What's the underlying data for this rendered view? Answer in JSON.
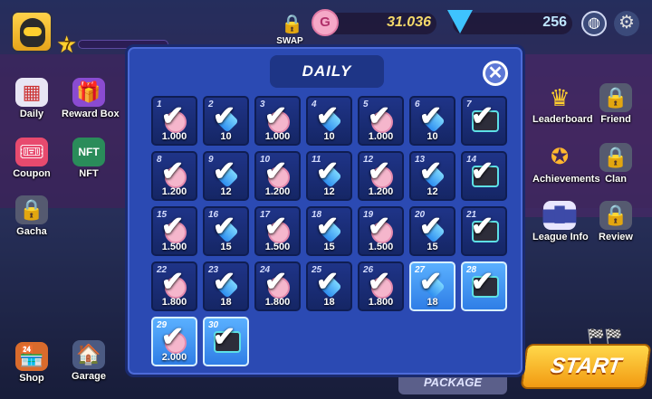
{
  "topbar": {
    "level": "7",
    "swap_label": "SWAP",
    "coin_icon_letter": "G",
    "coins": "31.036",
    "gems": "256"
  },
  "left_menu": [
    {
      "label": "Daily",
      "icon": "calendar-icon"
    },
    {
      "label": "Reward Box",
      "icon": "gift-icon"
    },
    {
      "label": "Coupon",
      "icon": "ticket-icon"
    },
    {
      "label": "NFT",
      "icon": "nft-icon"
    },
    {
      "label": "Gacha",
      "icon": "lock-icon"
    },
    {
      "label": "Shop",
      "icon": "shop-icon"
    },
    {
      "label": "Garage",
      "icon": "garage-icon"
    }
  ],
  "right_menu": [
    {
      "label": "Leaderboard",
      "icon": "crown-icon"
    },
    {
      "label": "Friend",
      "icon": "lock-icon"
    },
    {
      "label": "Achievements",
      "icon": "medal-icon"
    },
    {
      "label": "Clan",
      "icon": "lock-icon"
    },
    {
      "label": "League Info",
      "icon": "podium-icon"
    },
    {
      "label": "Review",
      "icon": "lock-icon"
    }
  ],
  "bottom": {
    "start_label": "START",
    "package_label": "PACKAGE"
  },
  "modal": {
    "title": "DAILY",
    "close_symbol": "✕",
    "rewards": [
      {
        "day": "1",
        "amount": "1.000",
        "type": "coin",
        "claimed": true
      },
      {
        "day": "2",
        "amount": "10",
        "type": "gem",
        "claimed": true
      },
      {
        "day": "3",
        "amount": "1.000",
        "type": "coin",
        "claimed": true
      },
      {
        "day": "4",
        "amount": "10",
        "type": "gem",
        "claimed": true
      },
      {
        "day": "5",
        "amount": "1.000",
        "type": "coin",
        "claimed": true
      },
      {
        "day": "6",
        "amount": "10",
        "type": "gem",
        "claimed": true
      },
      {
        "day": "7",
        "amount": "",
        "type": "chest",
        "claimed": true
      },
      {
        "day": "8",
        "amount": "1.200",
        "type": "coin",
        "claimed": true
      },
      {
        "day": "9",
        "amount": "12",
        "type": "gem",
        "claimed": true
      },
      {
        "day": "10",
        "amount": "1.200",
        "type": "coin",
        "claimed": true
      },
      {
        "day": "11",
        "amount": "12",
        "type": "gem",
        "claimed": true
      },
      {
        "day": "12",
        "amount": "1.200",
        "type": "coin",
        "claimed": true
      },
      {
        "day": "13",
        "amount": "12",
        "type": "gem",
        "claimed": true
      },
      {
        "day": "14",
        "amount": "",
        "type": "chest",
        "claimed": true
      },
      {
        "day": "15",
        "amount": "1.500",
        "type": "coin",
        "claimed": true
      },
      {
        "day": "16",
        "amount": "15",
        "type": "gem",
        "claimed": true
      },
      {
        "day": "17",
        "amount": "1.500",
        "type": "coin",
        "claimed": true
      },
      {
        "day": "18",
        "amount": "15",
        "type": "gem",
        "claimed": true
      },
      {
        "day": "19",
        "amount": "1.500",
        "type": "coin",
        "claimed": true
      },
      {
        "day": "20",
        "amount": "15",
        "type": "gem",
        "claimed": true
      },
      {
        "day": "21",
        "amount": "",
        "type": "chest",
        "claimed": true
      },
      {
        "day": "22",
        "amount": "1.800",
        "type": "coin",
        "claimed": true
      },
      {
        "day": "23",
        "amount": "18",
        "type": "gem",
        "claimed": true
      },
      {
        "day": "24",
        "amount": "1.800",
        "type": "coin",
        "claimed": true
      },
      {
        "day": "25",
        "amount": "18",
        "type": "gem",
        "claimed": true
      },
      {
        "day": "26",
        "amount": "1.800",
        "type": "coin",
        "claimed": true
      },
      {
        "day": "27",
        "amount": "18",
        "type": "gem",
        "claimed": true,
        "active": true
      },
      {
        "day": "28",
        "amount": "",
        "type": "chest",
        "claimed": true,
        "active": true
      },
      {
        "day": "29",
        "amount": "2.000",
        "type": "coin",
        "claimed": true,
        "active": true
      },
      {
        "day": "30",
        "amount": "",
        "type": "chest",
        "claimed": true,
        "active": true
      }
    ]
  }
}
